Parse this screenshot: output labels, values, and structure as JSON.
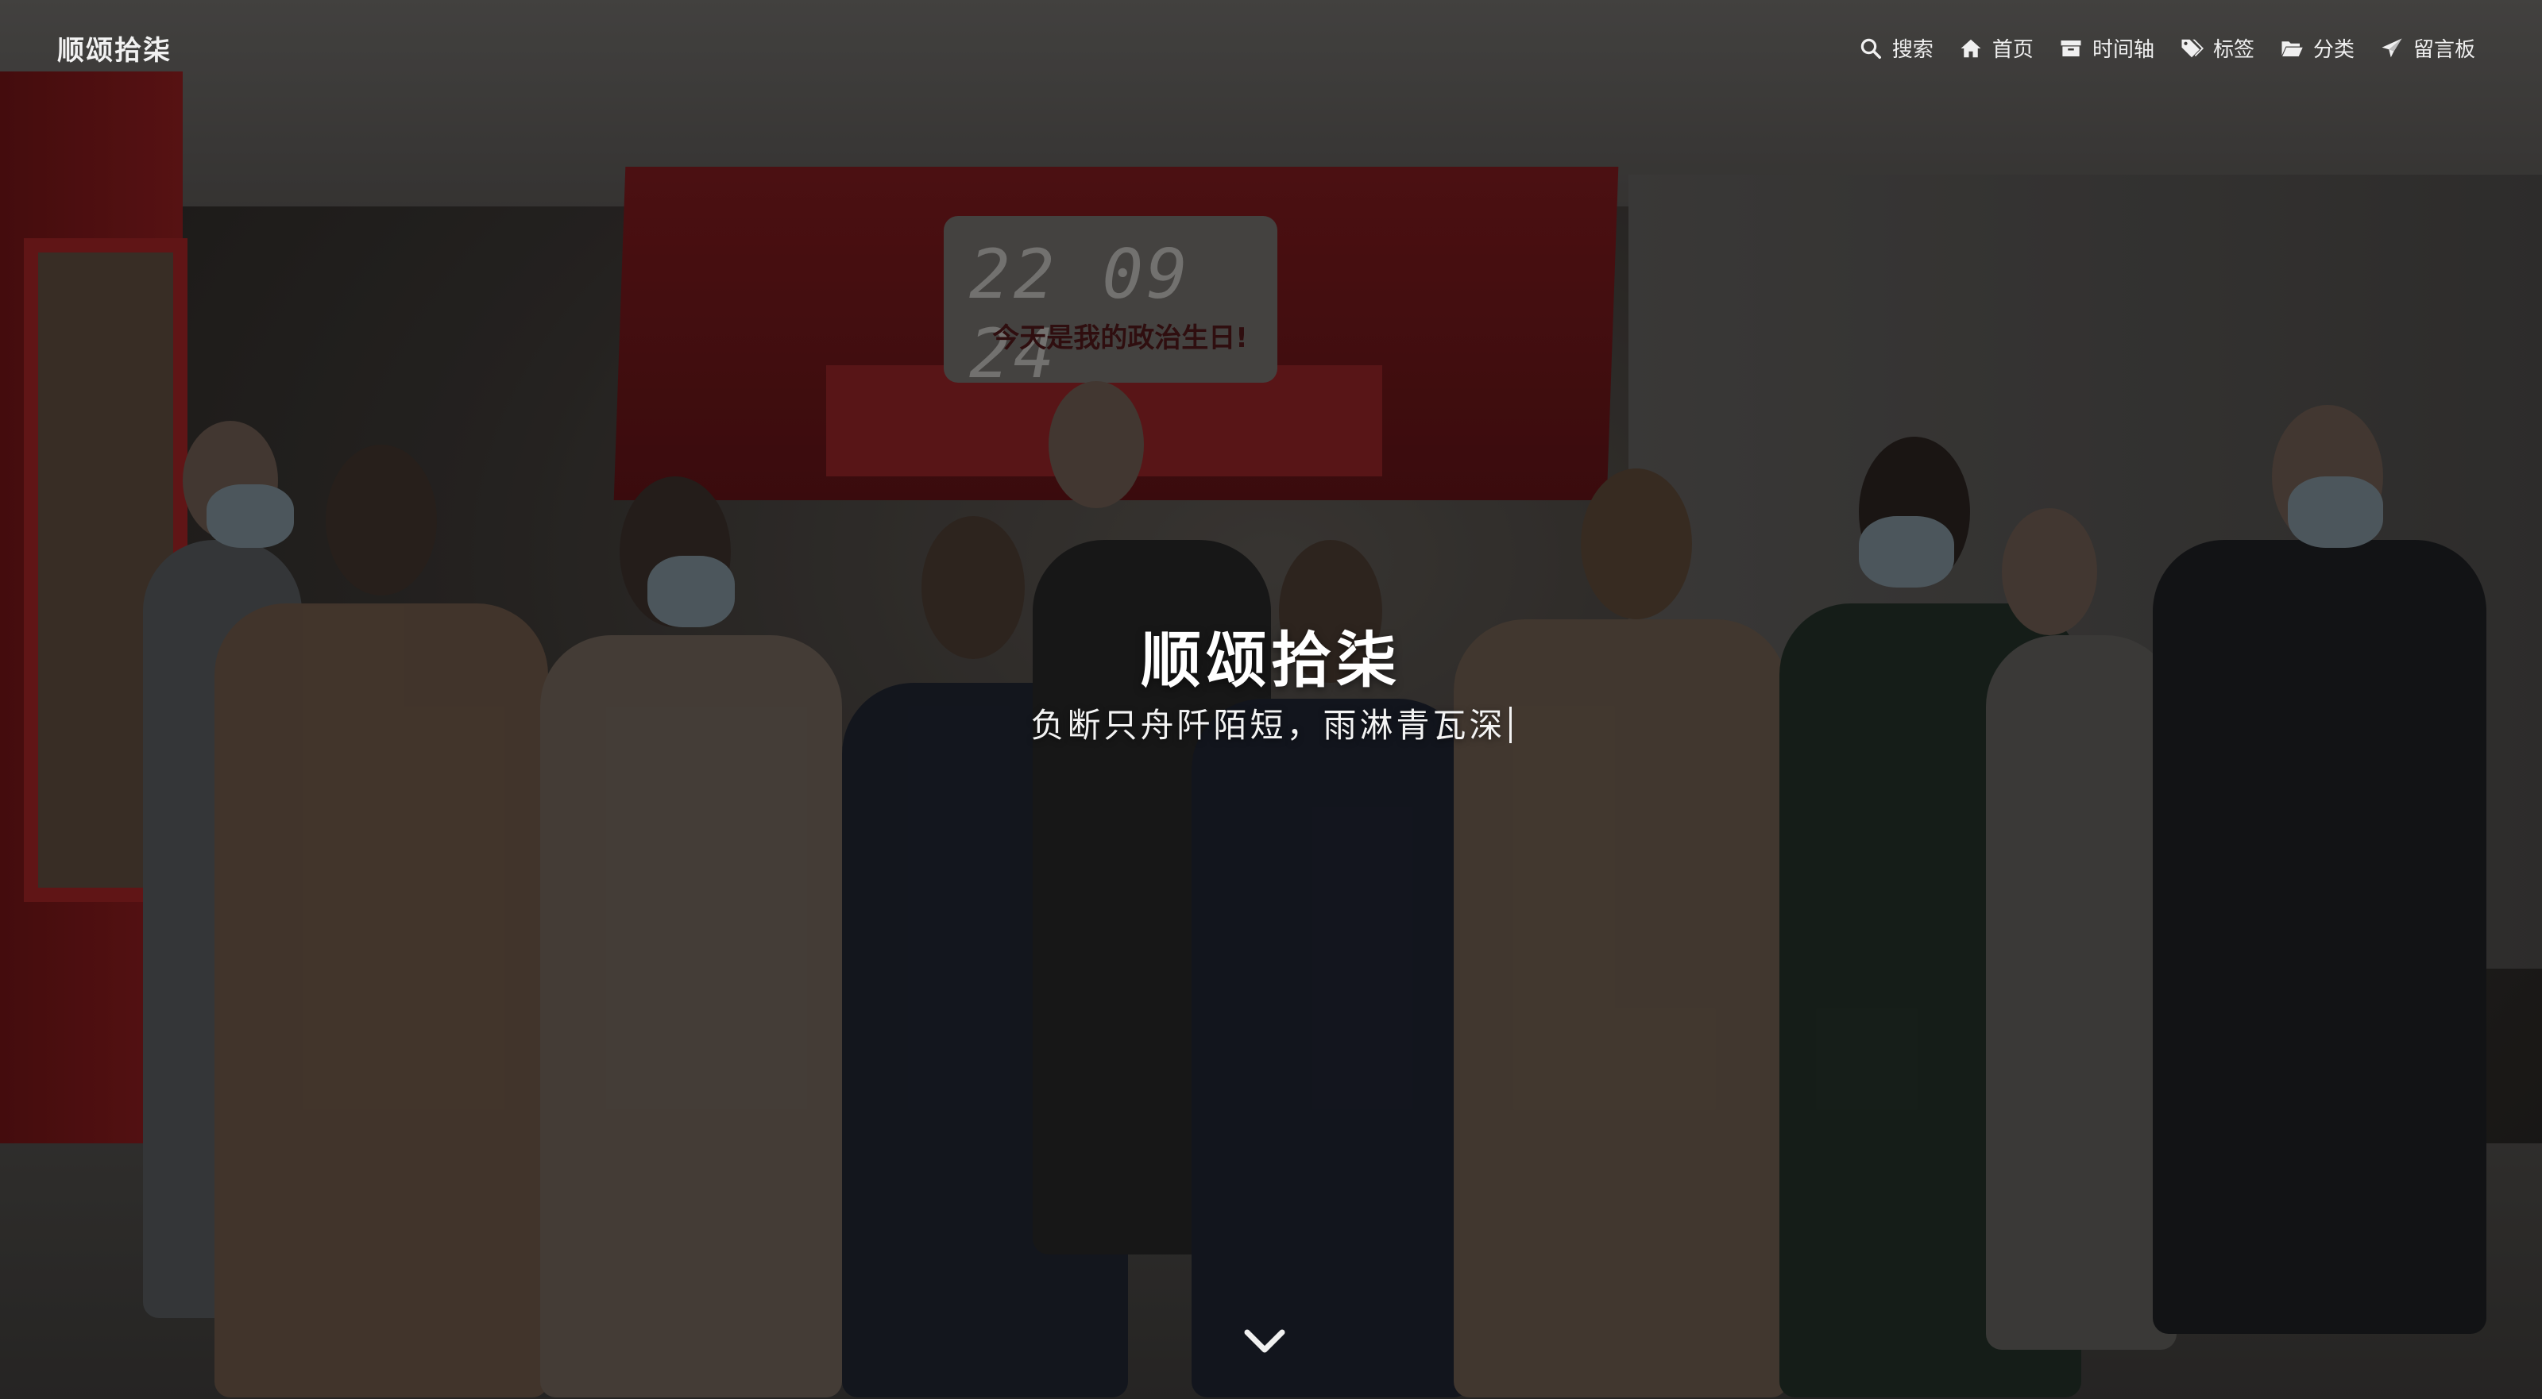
{
  "site": {
    "brand": "顺颂拾柒"
  },
  "nav": {
    "items": [
      {
        "label": "搜索",
        "icon": "search-icon"
      },
      {
        "label": "首页",
        "icon": "home-icon"
      },
      {
        "label": "时间轴",
        "icon": "archive-icon"
      },
      {
        "label": "标签",
        "icon": "tags-icon"
      },
      {
        "label": "分类",
        "icon": "folder-open-icon"
      },
      {
        "label": "留言板",
        "icon": "paper-plane-icon"
      }
    ]
  },
  "hero": {
    "title": "顺颂拾柒",
    "subtitle": "负断只舟阡陌短，雨淋青瓦深",
    "background": {
      "clock_text": "22 09 24",
      "banner_text": "今天是我的政治生日!"
    },
    "scroll_icon": "chevron-down-icon"
  },
  "colors": {
    "text": "#ffffff",
    "overlay": "rgba(0,0,0,0.38)"
  }
}
